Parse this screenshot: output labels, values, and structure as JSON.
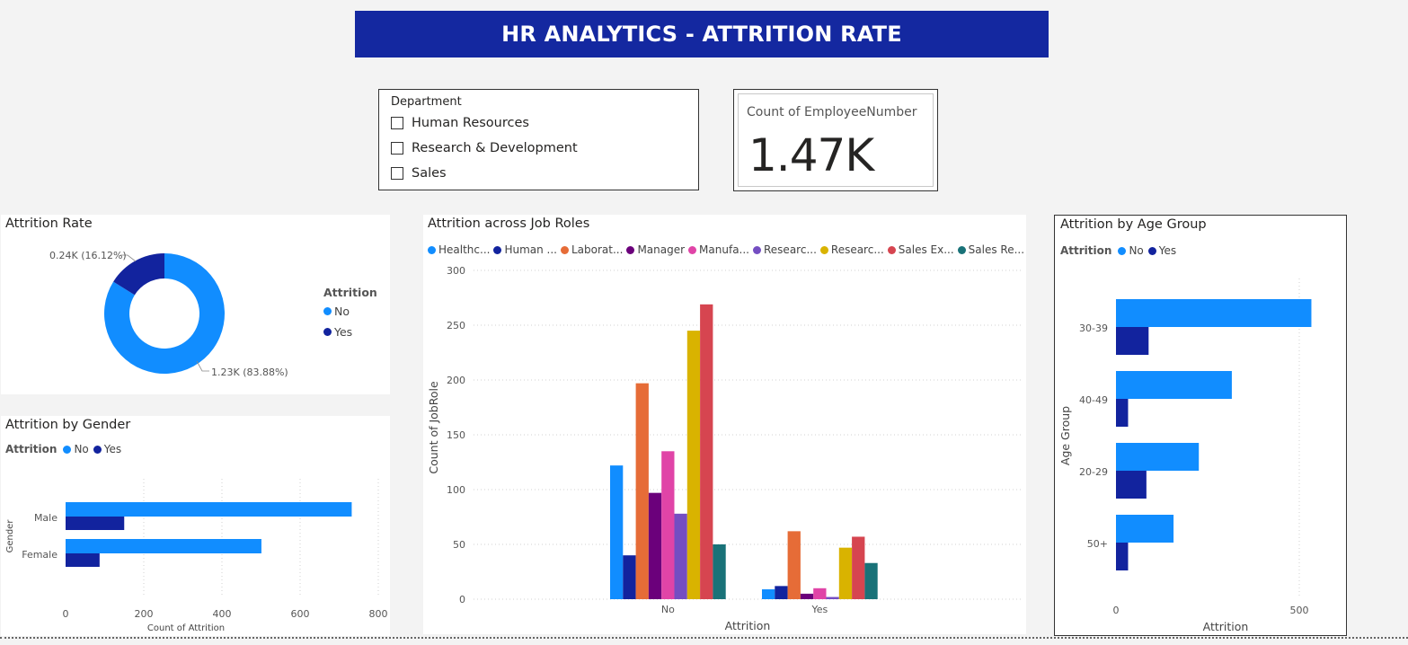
{
  "header": {
    "title": "HR ANALYTICS - ATTRITION RATE"
  },
  "colors": {
    "banner": "#1428a0",
    "no": "#118dff",
    "yes": "#12239e"
  },
  "department_slicer": {
    "title": "Department",
    "options": [
      {
        "label": "Human Resources",
        "checked": false
      },
      {
        "label": "Research & Development",
        "checked": false
      },
      {
        "label": "Sales",
        "checked": false
      }
    ]
  },
  "kpi_card": {
    "label": "Count of EmployeeNumber",
    "value": "1.47K"
  },
  "attrition_rate": {
    "title": "Attrition Rate",
    "legend_title": "Attrition",
    "legend": [
      "No",
      "Yes"
    ],
    "labels": {
      "no": "1.23K (83.88%)",
      "yes": "0.24K (16.12%)"
    }
  },
  "attrition_gender": {
    "title": "Attrition by Gender",
    "legend_title": "Attrition",
    "legend": [
      "No",
      "Yes"
    ]
  },
  "attrition_job_roles": {
    "title": "Attrition across Job Roles",
    "legend": [
      "Healthc...",
      "Human ...",
      "Laborat...",
      "Manager",
      "Manufa...",
      "Researc...",
      "Researc...",
      "Sales Ex...",
      "Sales Re..."
    ]
  },
  "attrition_age": {
    "title": "Attrition by Age Group",
    "legend_title": "Attrition",
    "legend": [
      "No",
      "Yes"
    ]
  },
  "chart_data": [
    {
      "type": "pie",
      "title": "Attrition Rate",
      "categories": [
        "No",
        "Yes"
      ],
      "values": [
        1233,
        237
      ],
      "colors": [
        "#118dff",
        "#12239e"
      ],
      "legend_position": "right"
    },
    {
      "type": "bar",
      "orientation": "horizontal",
      "title": "Attrition by Gender",
      "categories": [
        "Male",
        "Female"
      ],
      "series": [
        {
          "name": "No",
          "values": [
            732,
            501
          ],
          "color": "#118dff"
        },
        {
          "name": "Yes",
          "values": [
            150,
            87
          ],
          "color": "#12239e"
        }
      ],
      "xlabel": "Count of Attrition",
      "ylabel": "Gender",
      "xlim": [
        0,
        800
      ],
      "xticks": [
        0,
        200,
        400,
        600,
        800
      ],
      "legend_position": "top-left"
    },
    {
      "type": "bar",
      "title": "Attrition across Job Roles",
      "categories": [
        "No",
        "Yes"
      ],
      "series": [
        {
          "name": "Healthc...",
          "values": [
            122,
            9
          ],
          "color": "#118dff"
        },
        {
          "name": "Human ...",
          "values": [
            40,
            12
          ],
          "color": "#12239e"
        },
        {
          "name": "Laborat...",
          "values": [
            197,
            62
          ],
          "color": "#e66c37"
        },
        {
          "name": "Manager",
          "values": [
            97,
            5
          ],
          "color": "#6b007b"
        },
        {
          "name": "Manufa...",
          "values": [
            135,
            10
          ],
          "color": "#e044a7"
        },
        {
          "name": "Researc...",
          "values": [
            78,
            2
          ],
          "color": "#744ec2"
        },
        {
          "name": "Researc...",
          "values": [
            245,
            47
          ],
          "color": "#d9b300"
        },
        {
          "name": "Sales Ex...",
          "values": [
            269,
            57
          ],
          "color": "#d64550"
        },
        {
          "name": "Sales Re...",
          "values": [
            50,
            33
          ],
          "color": "#197278"
        }
      ],
      "xlabel": "Attrition",
      "ylabel": "Count of JobRole",
      "ylim": [
        0,
        300
      ],
      "yticks": [
        0,
        50,
        100,
        150,
        200,
        250,
        300
      ],
      "grid": true,
      "legend_position": "top"
    },
    {
      "type": "bar",
      "orientation": "horizontal",
      "title": "Attrition by Age Group",
      "categories": [
        "30-39",
        "40-49",
        "20-29",
        "50+"
      ],
      "series": [
        {
          "name": "No",
          "values": [
            533,
            316
          ],
          "color": "#118dff"
        },
        {
          "name": "Yes",
          "values": [
            89,
            33
          ],
          "color": "#12239e"
        }
      ],
      "series_full": [
        {
          "name": "No",
          "values": [
            533,
            316,
            226,
            157
          ]
        },
        {
          "name": "Yes",
          "values": [
            89,
            33,
            83,
            33
          ]
        }
      ],
      "xlabel": "Attrition",
      "ylabel": "Age Group",
      "xlim": [
        0,
        550
      ],
      "xticks": [
        0,
        500
      ],
      "legend_position": "top-left"
    }
  ]
}
